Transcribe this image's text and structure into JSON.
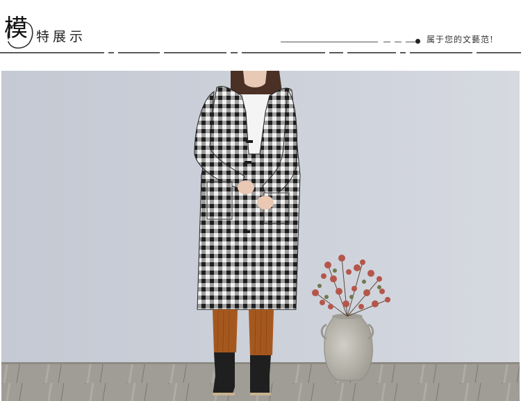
{
  "header": {
    "logo_char": "模",
    "title_rest": "特展示",
    "slogan": "属于您的文藝范!"
  },
  "photo": {
    "subject": "model-in-plaid-hooded-coat",
    "colors": {
      "wall": "#c9cdd6",
      "floor": "#a29e98",
      "coat_dark": "#2a2a2a",
      "coat_light": "#f2f2f2",
      "pants": "#a5581e",
      "vase": "#b9b7ad",
      "flowers": "#b5564a"
    }
  }
}
